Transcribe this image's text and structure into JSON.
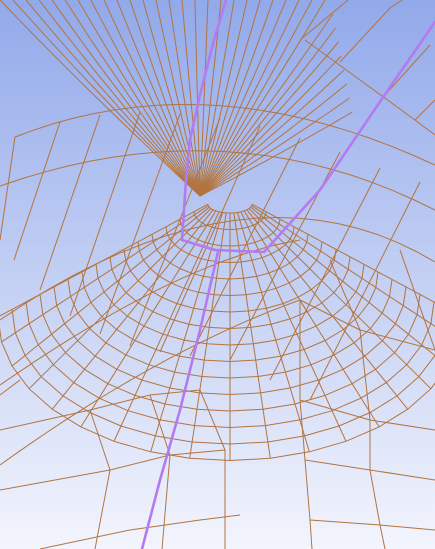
{
  "viewport": {
    "background_top": "#92a9ea",
    "background_bottom": "#f3f5fd"
  },
  "mesh": {
    "edge_color": "#b2743f",
    "highlight_color": "#b47af0"
  }
}
